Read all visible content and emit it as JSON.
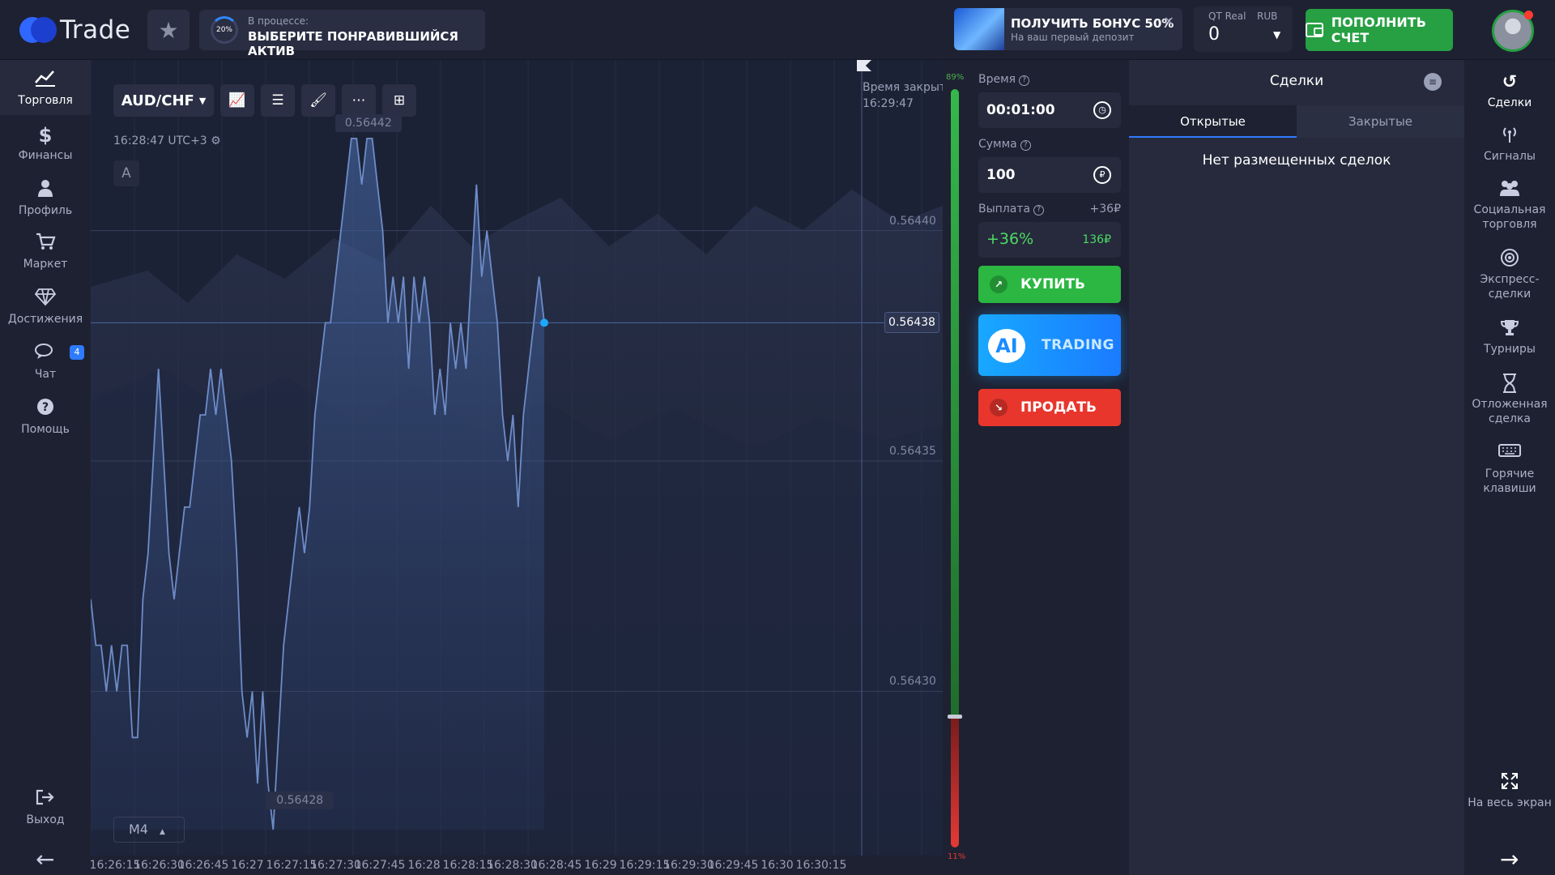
{
  "app": {
    "logo_text": "Trade"
  },
  "topbar": {
    "progress": {
      "percent_label": "20%",
      "status": "В процессе:",
      "task": "ВЫБЕРИТЕ ПОНРАВИВШИЙСЯ АКТИВ"
    },
    "bonus": {
      "title": "ПОЛУЧИТЬ БОНУС 50%",
      "subtitle": "На ваш первый депозит",
      "close": "×"
    },
    "account": {
      "type": "QT Real",
      "currency": "RUB",
      "balance": "0"
    },
    "deposit_label": "ПОПОЛНИТЬ СЧЕТ"
  },
  "left_nav": [
    {
      "label": "Торговля",
      "icon": "chart-line-icon",
      "glyph": "📈"
    },
    {
      "label": "Финансы",
      "icon": "dollar-icon",
      "glyph": "$"
    },
    {
      "label": "Профиль",
      "icon": "user-icon",
      "glyph": "👤"
    },
    {
      "label": "Маркет",
      "icon": "cart-icon",
      "glyph": "🛒"
    },
    {
      "label": "Достижения",
      "icon": "diamond-icon",
      "glyph": "💎"
    },
    {
      "label": "Чат",
      "icon": "chat-icon",
      "glyph": "💬",
      "badge": "4"
    },
    {
      "label": "Помощь",
      "icon": "help-icon",
      "glyph": "?"
    },
    {
      "label": "Выход",
      "icon": "logout-icon",
      "glyph": "⇥"
    }
  ],
  "chart": {
    "asset": "AUD/CHF",
    "clock": "16:28:47 UTC+3",
    "drawing_marker": "A",
    "timeframe": "M4",
    "close_time_label": "Время закрытия",
    "close_time": "16:29:47",
    "current_price": "0.56438",
    "max_label": "0.56442",
    "min_label": "0.56428",
    "price_levels": [
      "0.56440",
      "0.56435",
      "0.56430"
    ],
    "time_labels": [
      "16:26:15",
      "16:26:30",
      "16:26:45",
      "16:27",
      "16:27:15",
      "16:27:30",
      "16:27:45",
      "16:28",
      "16:28:15",
      "16:28:30",
      "16:28:45",
      "16:29",
      "16:29:15",
      "16:29:30",
      "16:29:45",
      "16:30",
      "16:30:15"
    ]
  },
  "sentiment": {
    "buy": "89%",
    "sell": "11%",
    "buy_fraction": 0.89
  },
  "trade_panel": {
    "time_label": "Время",
    "time_value": "00:01:00",
    "amount_label": "Сумма",
    "amount_value": "100",
    "amount_currency_symbol": "₽",
    "payout_label": "Выплата",
    "payout_extra": "+36₽",
    "payout_percent": "+36%",
    "payout_amount": "136₽",
    "buy_label": "КУПИТЬ",
    "ai_badge": "AI",
    "ai_label": "TRADING",
    "sell_label": "ПРОДАТЬ"
  },
  "deals": {
    "title": "Сделки",
    "tab_open": "Открытые",
    "tab_closed": "Закрытые",
    "empty": "Нет размещенных сделок"
  },
  "right_nav": [
    {
      "label": "Сделки",
      "icon": "history-icon",
      "glyph": "↺"
    },
    {
      "label": "Сигналы",
      "icon": "signal-icon",
      "glyph": "📡"
    },
    {
      "label": "Социальная торговля",
      "icon": "group-icon",
      "glyph": "👥"
    },
    {
      "label": "Экспресс-сделки",
      "icon": "target-icon",
      "glyph": "◎"
    },
    {
      "label": "Турниры",
      "icon": "trophy-icon",
      "glyph": "🏆"
    },
    {
      "label": "Отложенная сделка",
      "icon": "hourglass-icon",
      "glyph": "⌛"
    },
    {
      "label": "Горячие клавиши",
      "icon": "keyboard-icon",
      "glyph": "⌨"
    },
    {
      "label": "На весь экран",
      "icon": "fullscreen-icon",
      "glyph": "⤢"
    }
  ],
  "colors": {
    "buy": "#2bb741",
    "sell": "#e8362d",
    "accent": "#2f7bff",
    "deposit": "#279f43",
    "ai": "#1a8cff"
  },
  "chart_data": {
    "type": "line",
    "ylim": [
      0.56427,
      0.56443
    ],
    "x": [
      0,
      1,
      2,
      3,
      4,
      5,
      6,
      7,
      8,
      9,
      10,
      11,
      12,
      13,
      14,
      15,
      16,
      17,
      18,
      19,
      20,
      21,
      22,
      23,
      24,
      25,
      26,
      27,
      28,
      29,
      30,
      31,
      32,
      33,
      34,
      35,
      36,
      37,
      38,
      39,
      40,
      41,
      42,
      43,
      44,
      45,
      46,
      47,
      48,
      49,
      50,
      51,
      52,
      53,
      54,
      55,
      56,
      57,
      58,
      59,
      60,
      61,
      62,
      63,
      64,
      65,
      66,
      67,
      68,
      69,
      70,
      71,
      72,
      73,
      74,
      75,
      76,
      77,
      78,
      79,
      80,
      81,
      82,
      83,
      84,
      85,
      86,
      87,
      88,
      89,
      90,
      91,
      92,
      93,
      94,
      95,
      96,
      97,
      98,
      99,
      100,
      101,
      102,
      103,
      104,
      105,
      106,
      107,
      108,
      109,
      110,
      111,
      112,
      113,
      114,
      115,
      116,
      117,
      118,
      119,
      120,
      121,
      122,
      123,
      124,
      125,
      126,
      127,
      128,
      129,
      130,
      131,
      132,
      133,
      134,
      135,
      136,
      137,
      138,
      139,
      140,
      141,
      142,
      143,
      144,
      145,
      146,
      147,
      148,
      149,
      150,
      151,
      152,
      153,
      154,
      155,
      156,
      157
    ],
    "values": [
      0.56432,
      0.56431,
      0.56431,
      0.5643,
      0.56431,
      0.5643,
      0.56431,
      0.56431,
      0.56429,
      0.56429,
      0.56432,
      0.56433,
      0.56435,
      0.56437,
      0.56435,
      0.56433,
      0.56432,
      0.56433,
      0.56434,
      0.56434,
      0.56435,
      0.56436,
      0.56436,
      0.56437,
      0.56436,
      0.56437,
      0.56436,
      0.56435,
      0.56433,
      0.5643,
      0.56429,
      0.5643,
      0.56428,
      0.5643,
      0.56428,
      0.56427,
      0.56429,
      0.56431,
      0.56432,
      0.56433,
      0.56434,
      0.56433,
      0.56434,
      0.56436,
      0.56437,
      0.56438,
      0.56438,
      0.56439,
      0.5644,
      0.56441,
      0.56442,
      0.56442,
      0.56441,
      0.56442,
      0.56442,
      0.56441,
      0.5644,
      0.56438,
      0.56439,
      0.56438,
      0.56439,
      0.56437,
      0.56439,
      0.56438,
      0.56439,
      0.56438,
      0.56436,
      0.56437,
      0.56436,
      0.56438,
      0.56437,
      0.56438,
      0.56437,
      0.56439,
      0.56441,
      0.56439,
      0.5644,
      0.56439,
      0.56438,
      0.56436,
      0.56435,
      0.56436,
      0.56434,
      0.56436,
      0.56437,
      0.56438,
      0.56439,
      0.56438
    ],
    "current": 0.56438,
    "max": 0.56442,
    "min": 0.56428
  }
}
